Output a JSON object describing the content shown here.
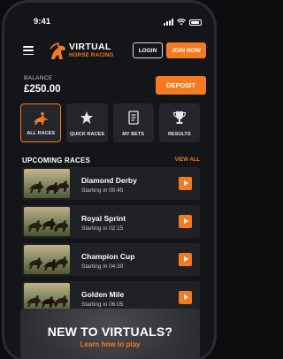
{
  "status_bar": {
    "time": "9:41"
  },
  "header": {
    "logo_line1": "VIRTUAL",
    "logo_line2": "HORSE RACING",
    "login_label": "LOGIN",
    "join_label": "JOIN NOW"
  },
  "balance": {
    "label": "BALANCE",
    "value": "£250.00",
    "deposit_label": "DEPOSIT"
  },
  "nav_tiles": [
    {
      "label": "ALL RACES",
      "icon": "horse-racing-icon",
      "active": true
    },
    {
      "label": "QUICK RACES",
      "icon": "star-icon",
      "active": false
    },
    {
      "label": "MY BETS",
      "icon": "bet-slip-icon",
      "active": false
    },
    {
      "label": "RESULTS",
      "icon": "trophy-icon",
      "active": false
    }
  ],
  "upcoming": {
    "title": "UPCOMING RACES",
    "view_all": "VIEW ALL",
    "races": [
      {
        "name": "Diamond Derby",
        "starting": "Starting in 00:45"
      },
      {
        "name": "Royal Sprint",
        "starting": "Starting in 02:15"
      },
      {
        "name": "Champion Cup",
        "starting": "Starting in 04:30"
      },
      {
        "name": "Golden Mile",
        "starting": "Starting in 06:05"
      }
    ]
  },
  "banner": {
    "title": "NEW TO VIRTUALS?",
    "subtitle": "Learn how to play"
  },
  "colors": {
    "accent": "#f47b20",
    "background": "#141519",
    "card": "#1f2126"
  }
}
